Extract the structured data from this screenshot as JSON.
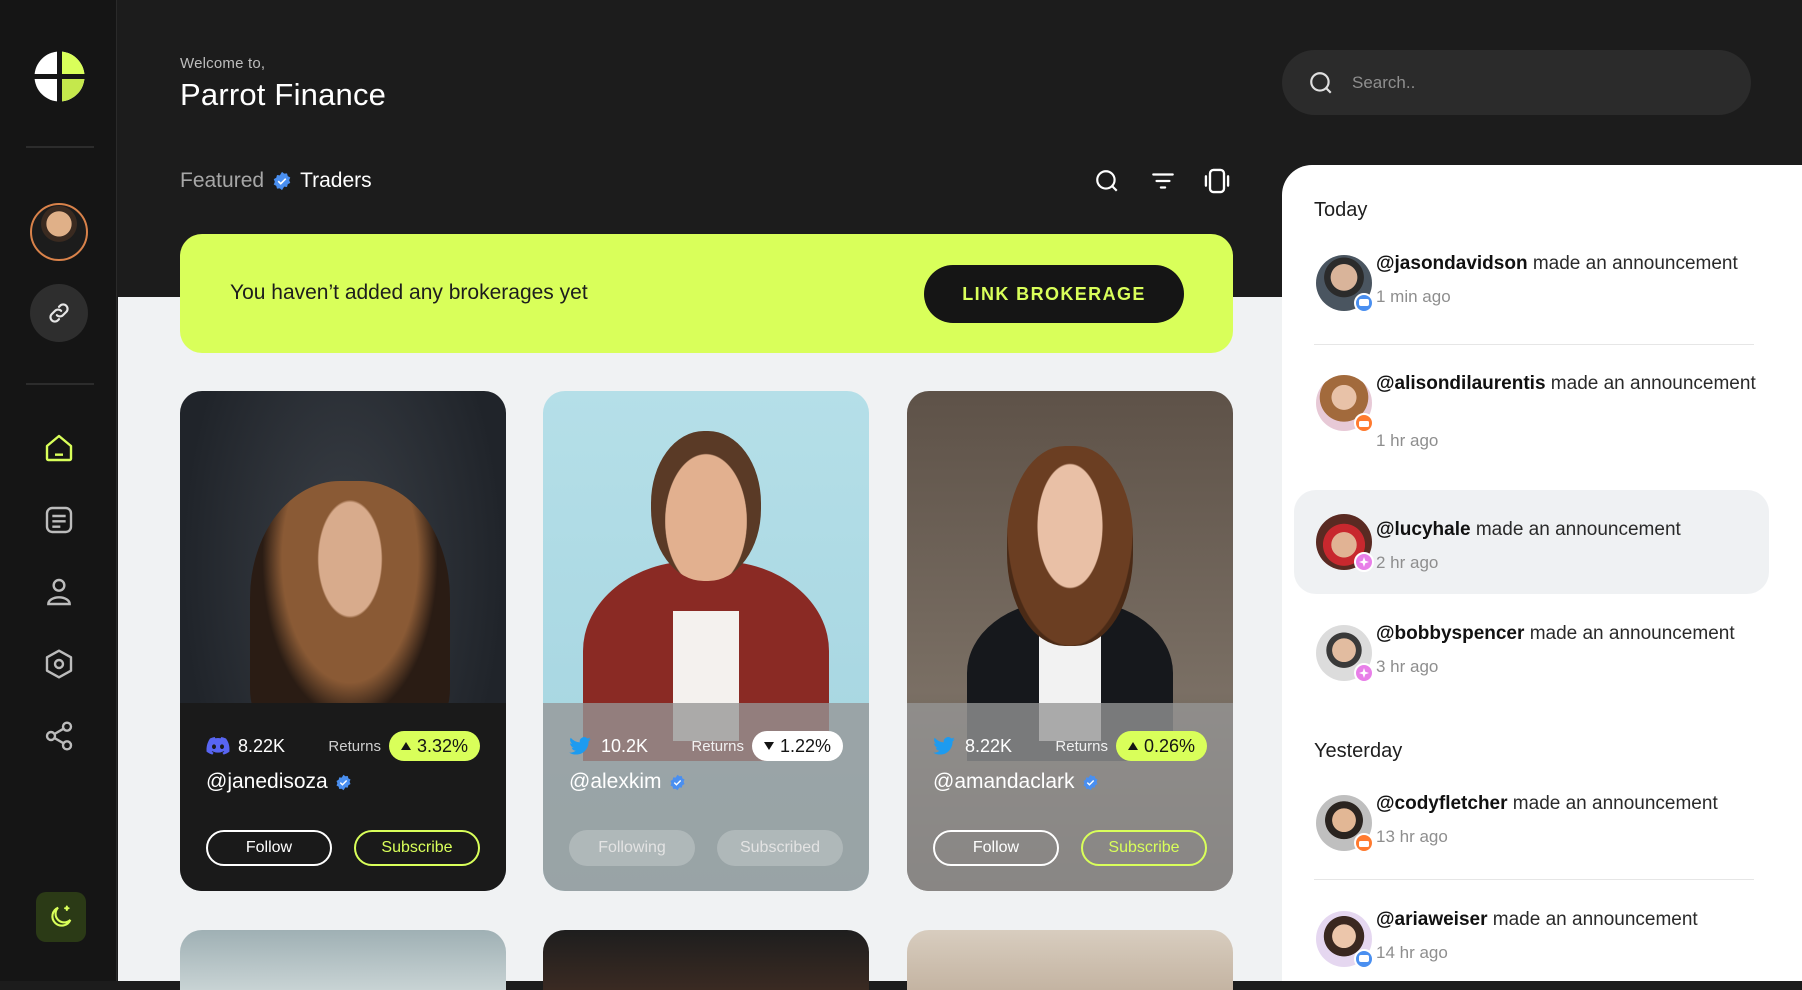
{
  "app": {
    "welcome": "Welcome to,",
    "title": "Parrot Finance"
  },
  "search": {
    "placeholder": "Search.."
  },
  "section": {
    "prefix": "Featured",
    "title": "Traders"
  },
  "toolbar": {
    "icons": [
      "search-icon",
      "filter-icon",
      "vibrate-icon"
    ]
  },
  "banner": {
    "message": "You haven’t added any brokerages yet",
    "button": "LINK BROKERAGE"
  },
  "colors": {
    "accent": "#d9ff5a",
    "dark": "#1c1c1c",
    "verified": "#4a8ff0"
  },
  "traders": [
    {
      "handle": "@janedisoza",
      "followers": "8.22K",
      "social": "discord-icon",
      "returns_label": "Returns",
      "returns": "3.32%",
      "trend": "up",
      "follow_label": "Follow",
      "subscribe_label": "Subscribe"
    },
    {
      "handle": "@alexkim",
      "followers": "10.2K",
      "social": "twitter-icon",
      "returns_label": "Returns",
      "returns": "1.22%",
      "trend": "down",
      "follow_label": "Following",
      "subscribe_label": "Subscribed"
    },
    {
      "handle": "@amandaclark",
      "followers": "8.22K",
      "social": "twitter-icon",
      "returns_label": "Returns",
      "returns": "0.26%",
      "trend": "up",
      "follow_label": "Follow",
      "subscribe_label": "Subscribe"
    }
  ],
  "notifications": {
    "today_label": "Today",
    "yesterday_label": "Yesterday",
    "action": "made an announcement",
    "items": [
      {
        "user": "@jasondavidson",
        "time": "1 min ago",
        "badge": "chat-icon"
      },
      {
        "user": "@alisondilaurentis",
        "time": "1 hr ago",
        "badge": "broadcast-icon"
      },
      {
        "user": "@lucyhale",
        "time": "2 hr ago",
        "badge": "sparkle-icon"
      },
      {
        "user": "@bobbyspencer",
        "time": "3 hr ago",
        "badge": "sparkle-icon"
      },
      {
        "user": "@codyfletcher",
        "time": "13 hr ago",
        "badge": "broadcast-icon"
      },
      {
        "user": "@ariaweiser",
        "time": "14 hr ago",
        "badge": "chat-icon"
      }
    ]
  },
  "sidebar": {
    "items": [
      "home-icon",
      "document-icon",
      "user-icon",
      "settings-icon",
      "share-icon"
    ],
    "theme_toggle": "moon-icon"
  }
}
